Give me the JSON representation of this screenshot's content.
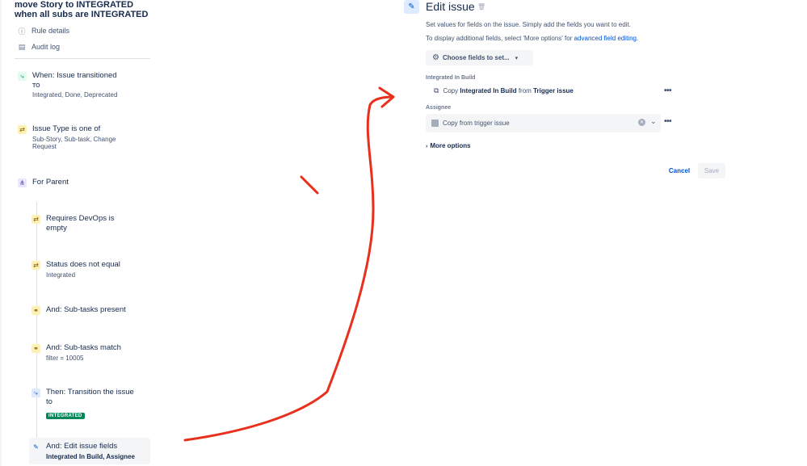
{
  "rule": {
    "title": "move Story to INTEGRATED when all subs are INTEGRATED",
    "meta": [
      {
        "label": "Rule details",
        "icon": "info-icon"
      },
      {
        "label": "Audit log",
        "icon": "document-icon"
      }
    ]
  },
  "steps": {
    "trigger": {
      "title": "When: Issue transitioned",
      "to_label": "TO",
      "sub": "Integrated, Done, Deprecated"
    },
    "issue_type": {
      "title": "Issue Type is one of",
      "sub": "Sub-Story, Sub-task, Change Request"
    },
    "branch": {
      "title": "For Parent"
    },
    "devops": {
      "title": "Requires DevOps is empty"
    },
    "status": {
      "title": "Status does not equal",
      "sub": "Integrated"
    },
    "subtasks_present": {
      "title": "And: Sub-tasks present"
    },
    "subtasks_match": {
      "title": "And: Sub-tasks match",
      "sub": "filter = 10005"
    },
    "transition": {
      "title": "Then: Transition the issue to",
      "badge": "INTEGRATED"
    },
    "edit_fields": {
      "title": "And: Edit issue fields",
      "sub": "Integrated In Build, Assignee"
    }
  },
  "edit": {
    "title": "Edit issue",
    "desc1": "Set values for fields on the issue. Simply add the fields you want to edit.",
    "desc2_prefix": "To display additional fields, select 'More options' for ",
    "desc2_link": "advanced field editing.",
    "choose_label": "Choose fields to set...",
    "field1_label": "Integrated In Build",
    "copy_prefix": "Copy ",
    "copy_field": "Integrated In Build",
    "copy_mid": " from ",
    "copy_source": "Trigger issue",
    "field2_label": "Assignee",
    "assignee_value": "Copy from trigger issue",
    "more_options": "More options",
    "cancel": "Cancel",
    "save": "Save"
  },
  "colors": {
    "accent": "#0052cc",
    "annotation": "#e8301c",
    "badge_green": "#00875a"
  }
}
